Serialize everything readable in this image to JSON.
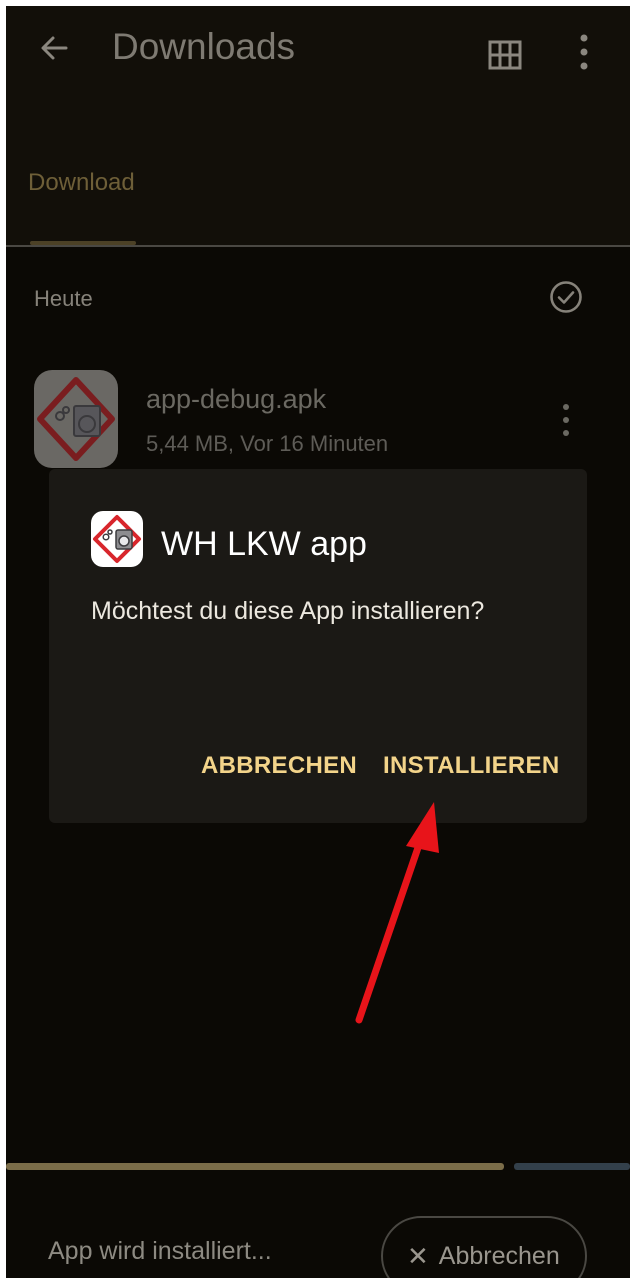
{
  "toolbar": {
    "title": "Downloads"
  },
  "tabs": [
    {
      "label": "Download"
    }
  ],
  "section": {
    "label": "Heute"
  },
  "file": {
    "name": "app-debug.apk",
    "meta": "5,44 MB, Vor 16 Minuten"
  },
  "dialog": {
    "title": "WH LKW app",
    "message": "Möchtest du diese App installieren?",
    "cancel_label": "ABBRECHEN",
    "install_label": "INSTALLIEREN"
  },
  "status": {
    "text": "App wird installiert...",
    "abort_label": "Abbrechen",
    "progress_fraction": 0.8
  },
  "colors": {
    "accent": "#f3d48a",
    "arrow": "#e8141a",
    "dialog_bg": "#1b1915",
    "app_icon_red": "#d8262c"
  },
  "icons": [
    "back-arrow-icon",
    "grid-view-icon",
    "more-vert-icon",
    "check-circle-icon",
    "app-icon",
    "close-icon"
  ]
}
